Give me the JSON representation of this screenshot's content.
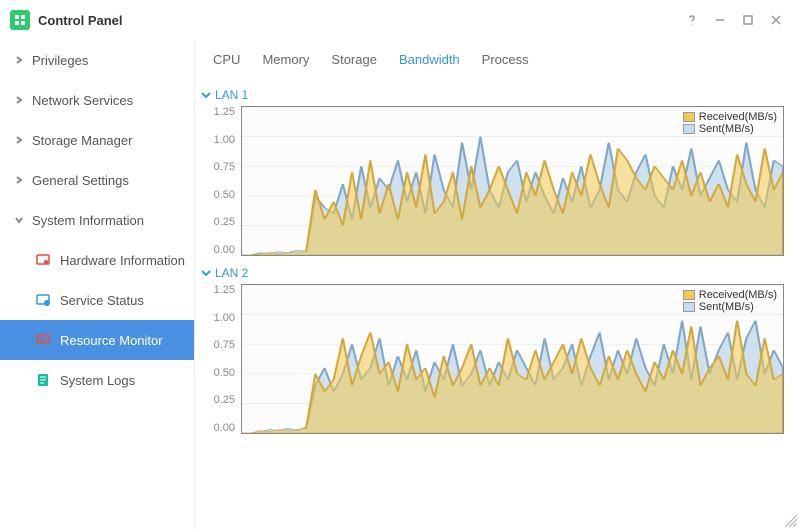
{
  "window": {
    "title": "Control Panel"
  },
  "sidebar": {
    "items": [
      {
        "label": "Privileges",
        "expanded": false
      },
      {
        "label": "Network Services",
        "expanded": false
      },
      {
        "label": "Storage Manager",
        "expanded": false
      },
      {
        "label": "General Settings",
        "expanded": false
      },
      {
        "label": "System Information",
        "expanded": true
      }
    ],
    "sub": [
      {
        "label": "Hardware Information",
        "icon": "hardware",
        "color": "#e74c3c"
      },
      {
        "label": "Service Status",
        "icon": "service",
        "color": "#3498db"
      },
      {
        "label": "Resource Monitor",
        "icon": "monitor",
        "color": "#e74c3c",
        "active": true
      },
      {
        "label": "System Logs",
        "icon": "logs",
        "color": "#1bbc9b"
      }
    ]
  },
  "tabs": [
    {
      "label": "CPU"
    },
    {
      "label": "Memory"
    },
    {
      "label": "Storage"
    },
    {
      "label": "Bandwidth",
      "active": true
    },
    {
      "label": "Process"
    }
  ],
  "legend": {
    "received": "Received(MB/s)",
    "sent": "Sent(MB/s)"
  },
  "sections": [
    {
      "label": "LAN 1"
    },
    {
      "label": "LAN 2"
    }
  ],
  "chart_data": [
    {
      "type": "area",
      "title": "LAN 1",
      "ylabel": "MB/s",
      "ylim": [
        0,
        1.25
      ],
      "yticks": [
        0.0,
        0.25,
        0.5,
        0.75,
        1.0,
        1.25
      ],
      "x": [
        0,
        1,
        2,
        3,
        4,
        5,
        6,
        7,
        8,
        9,
        10,
        11,
        12,
        13,
        14,
        15,
        16,
        17,
        18,
        19,
        20,
        21,
        22,
        23,
        24,
        25,
        26,
        27,
        28,
        29,
        30,
        31,
        32,
        33,
        34,
        35,
        36,
        37,
        38,
        39,
        40,
        41,
        42,
        43,
        44,
        45,
        46,
        47,
        48,
        49,
        50,
        51,
        52,
        53,
        54,
        55,
        56,
        57,
        58,
        59
      ],
      "series": [
        {
          "name": "Received(MB/s)",
          "color": "#f3c94f",
          "values": [
            0.0,
            0.0,
            0.01,
            0.02,
            0.01,
            0.02,
            0.02,
            0.03,
            0.55,
            0.3,
            0.45,
            0.25,
            0.7,
            0.3,
            0.8,
            0.35,
            0.6,
            0.3,
            0.7,
            0.4,
            0.85,
            0.35,
            0.45,
            0.7,
            0.3,
            0.75,
            0.4,
            0.55,
            0.75,
            0.55,
            0.35,
            0.7,
            0.5,
            0.8,
            0.55,
            0.35,
            0.7,
            0.5,
            0.85,
            0.6,
            0.4,
            0.9,
            0.8,
            0.65,
            0.55,
            0.75,
            0.65,
            0.55,
            0.8,
            0.5,
            0.7,
            0.45,
            0.6,
            0.4,
            0.85,
            0.6,
            0.45,
            0.9,
            0.55,
            0.7
          ]
        },
        {
          "name": "Sent(MB/s)",
          "color": "#a9cbe4",
          "values": [
            0.0,
            0.0,
            0.02,
            0.01,
            0.03,
            0.02,
            0.04,
            0.03,
            0.5,
            0.4,
            0.35,
            0.6,
            0.3,
            0.75,
            0.4,
            0.65,
            0.55,
            0.8,
            0.45,
            0.7,
            0.35,
            0.85,
            0.55,
            0.4,
            0.95,
            0.55,
            1.0,
            0.55,
            0.4,
            0.7,
            0.8,
            0.45,
            0.7,
            0.5,
            0.35,
            0.65,
            0.45,
            0.75,
            0.4,
            0.55,
            0.95,
            0.55,
            0.45,
            0.7,
            0.85,
            0.5,
            0.4,
            0.75,
            0.55,
            0.9,
            0.5,
            0.65,
            0.8,
            0.55,
            0.45,
            0.95,
            0.55,
            0.4,
            0.8,
            0.75
          ]
        }
      ]
    },
    {
      "type": "area",
      "title": "LAN 2",
      "ylabel": "MB/s",
      "ylim": [
        0,
        1.25
      ],
      "yticks": [
        0.0,
        0.25,
        0.5,
        0.75,
        1.0,
        1.25
      ],
      "x": [
        0,
        1,
        2,
        3,
        4,
        5,
        6,
        7,
        8,
        9,
        10,
        11,
        12,
        13,
        14,
        15,
        16,
        17,
        18,
        19,
        20,
        21,
        22,
        23,
        24,
        25,
        26,
        27,
        28,
        29,
        30,
        31,
        32,
        33,
        34,
        35,
        36,
        37,
        38,
        39,
        40,
        41,
        42,
        43,
        44,
        45,
        46,
        47,
        48,
        49,
        50,
        51,
        52,
        53,
        54,
        55,
        56,
        57,
        58,
        59
      ],
      "series": [
        {
          "name": "Received(MB/s)",
          "color": "#f3c94f",
          "values": [
            0.0,
            0.0,
            0.02,
            0.01,
            0.03,
            0.02,
            0.03,
            0.04,
            0.5,
            0.35,
            0.45,
            0.8,
            0.4,
            0.65,
            0.85,
            0.5,
            0.6,
            0.35,
            0.75,
            0.45,
            0.55,
            0.3,
            0.65,
            0.4,
            0.55,
            0.75,
            0.4,
            0.55,
            0.4,
            0.8,
            0.5,
            0.45,
            0.7,
            0.45,
            0.6,
            0.75,
            0.5,
            0.8,
            0.55,
            0.4,
            0.65,
            0.45,
            0.7,
            0.5,
            0.35,
            0.6,
            0.45,
            0.7,
            0.5,
            0.9,
            0.4,
            0.55,
            0.65,
            0.45,
            0.95,
            0.5,
            0.4,
            0.8,
            0.45,
            0.5
          ]
        },
        {
          "name": "Sent(MB/s)",
          "color": "#a9cbe4",
          "values": [
            0.0,
            0.0,
            0.01,
            0.03,
            0.02,
            0.04,
            0.02,
            0.05,
            0.4,
            0.55,
            0.35,
            0.5,
            0.75,
            0.45,
            0.55,
            0.8,
            0.4,
            0.65,
            0.45,
            0.7,
            0.35,
            0.6,
            0.45,
            0.75,
            0.4,
            0.5,
            0.7,
            0.4,
            0.6,
            0.45,
            0.7,
            0.55,
            0.4,
            0.8,
            0.45,
            0.55,
            0.75,
            0.4,
            0.65,
            0.85,
            0.45,
            0.7,
            0.5,
            0.8,
            0.55,
            0.4,
            0.75,
            0.5,
            0.95,
            0.45,
            0.9,
            0.5,
            0.7,
            0.85,
            0.45,
            0.8,
            0.95,
            0.5,
            0.7,
            0.55
          ]
        }
      ]
    }
  ]
}
